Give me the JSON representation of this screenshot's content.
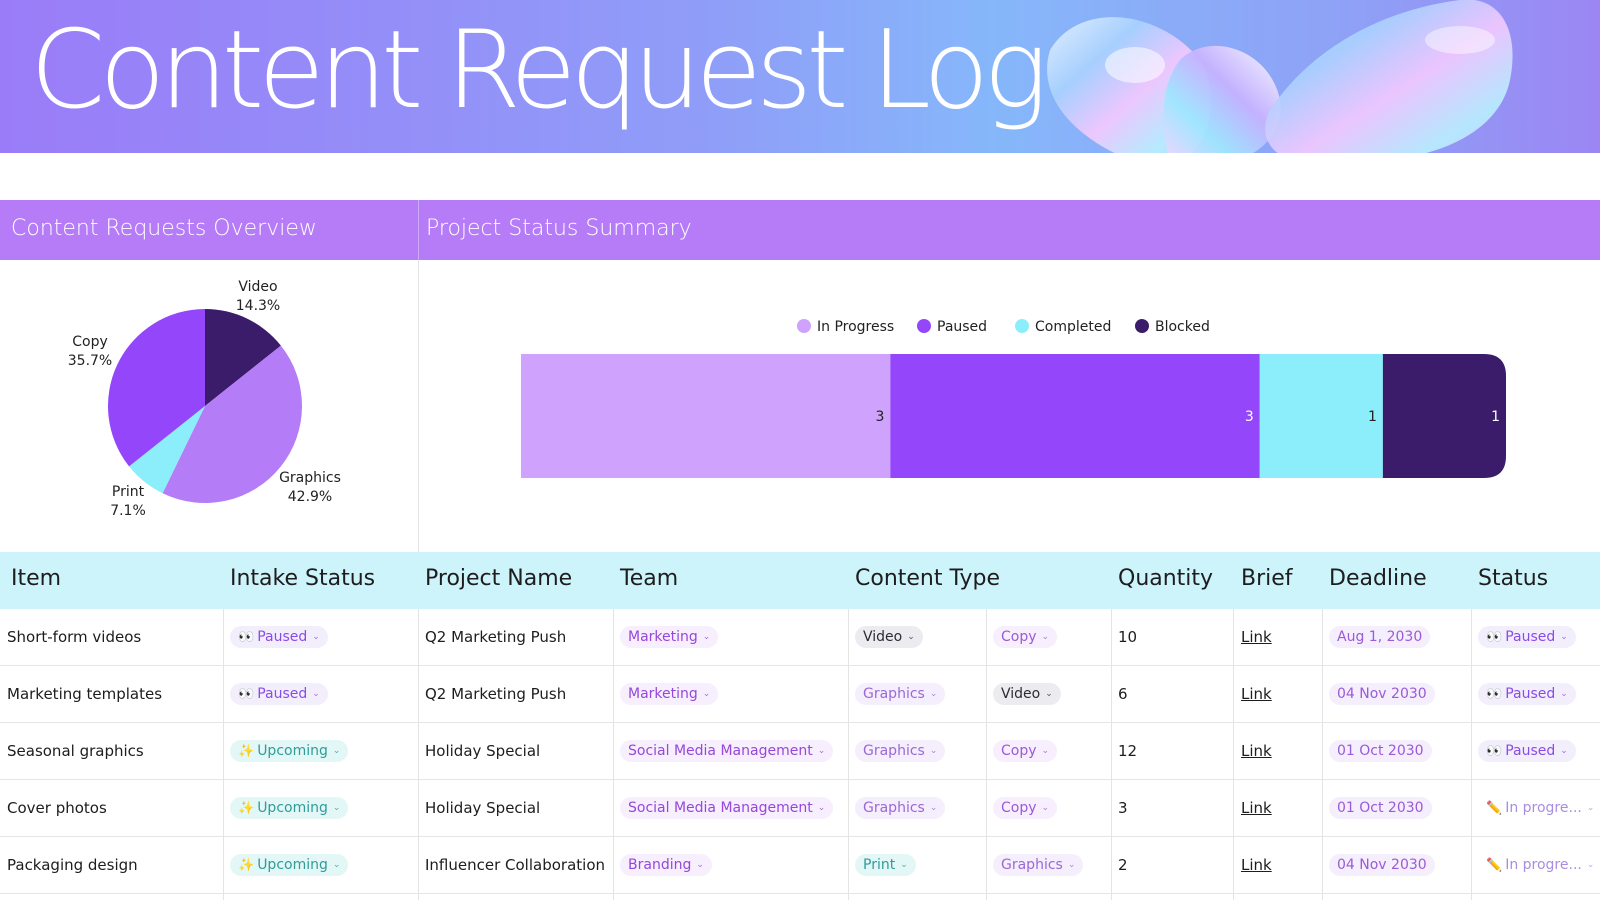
{
  "banner": {
    "title": "Content Request Log"
  },
  "sections": {
    "overview_title": "Content Requests Overview",
    "status_title": "Project Status Summary"
  },
  "chart_data": [
    {
      "type": "pie",
      "title": "",
      "slices": [
        {
          "label": "Video",
          "percent_label": "14.3%",
          "value": 14.3,
          "color": "#3a1c6a"
        },
        {
          "label": "Graphics",
          "percent_label": "42.9%",
          "value": 42.9,
          "color": "#b57cf8"
        },
        {
          "label": "Print",
          "percent_label": "7.1%",
          "value": 7.1,
          "color": "#8ceefb"
        },
        {
          "label": "Copy",
          "percent_label": "35.7%",
          "value": 35.7,
          "color": "#9446fb"
        }
      ]
    },
    {
      "type": "bar",
      "orientation": "horizontal",
      "stacked": true,
      "title": "",
      "legend_position": "top",
      "series": [
        {
          "name": "In Progress",
          "value": 3,
          "color": "#cea2fd"
        },
        {
          "name": "Paused",
          "value": 3,
          "color": "#9446fb"
        },
        {
          "name": "Completed",
          "value": 1,
          "color": "#8ceefb"
        },
        {
          "name": "Blocked",
          "value": 1,
          "color": "#3a1c6a"
        }
      ]
    }
  ],
  "table": {
    "headers": [
      "Item",
      "Intake Status",
      "Project Name",
      "Team",
      "Content Type",
      "Quantity",
      "Brief",
      "Deadline",
      "Status"
    ],
    "rows": [
      {
        "item": "Short-form videos",
        "intake": {
          "icon": "eyes-icon",
          "emoji": "👀",
          "label": "Paused",
          "kind": "paused"
        },
        "project": "Q2 Marketing Push",
        "team": "Marketing",
        "type1": {
          "label": "Video",
          "kind": "video"
        },
        "type2": {
          "label": "Copy",
          "kind": "copy"
        },
        "quantity": "10",
        "brief": "Link",
        "deadline": "Aug 1, 2030",
        "status": {
          "icon": "eyes-icon",
          "emoji": "👀",
          "label": "Paused",
          "kind": "paused"
        }
      },
      {
        "item": "Marketing templates",
        "intake": {
          "icon": "eyes-icon",
          "emoji": "👀",
          "label": "Paused",
          "kind": "paused"
        },
        "project": "Q2 Marketing Push",
        "team": "Marketing",
        "type1": {
          "label": "Graphics",
          "kind": "graphics"
        },
        "type2": {
          "label": "Video",
          "kind": "video"
        },
        "quantity": "6",
        "brief": "Link",
        "deadline": "04 Nov 2030",
        "status": {
          "icon": "eyes-icon",
          "emoji": "👀",
          "label": "Paused",
          "kind": "paused"
        }
      },
      {
        "item": "Seasonal graphics",
        "intake": {
          "icon": "sparkles-icon",
          "emoji": "✨",
          "label": "Upcoming",
          "kind": "upcoming"
        },
        "project": "Holiday Special",
        "team": "Social Media Management",
        "type1": {
          "label": "Graphics",
          "kind": "graphics"
        },
        "type2": {
          "label": "Copy",
          "kind": "copy"
        },
        "quantity": "12",
        "brief": "Link",
        "deadline": "01 Oct 2030",
        "status": {
          "icon": "eyes-icon",
          "emoji": "👀",
          "label": "Paused",
          "kind": "paused"
        }
      },
      {
        "item": "Cover photos",
        "intake": {
          "icon": "sparkles-icon",
          "emoji": "✨",
          "label": "Upcoming",
          "kind": "upcoming"
        },
        "project": "Holiday Special",
        "team": "Social Media Management",
        "type1": {
          "label": "Graphics",
          "kind": "graphics"
        },
        "type2": {
          "label": "Copy",
          "kind": "copy"
        },
        "quantity": "3",
        "brief": "Link",
        "deadline": "01 Oct 2030",
        "status": {
          "icon": "pencil-icon",
          "emoji": "✏️",
          "label": "In progre...",
          "kind": "prog"
        }
      },
      {
        "item": "Packaging design",
        "intake": {
          "icon": "sparkles-icon",
          "emoji": "✨",
          "label": "Upcoming",
          "kind": "upcoming"
        },
        "project": "Influencer Collaboration",
        "team": "Branding",
        "type1": {
          "label": "Print",
          "kind": "print"
        },
        "type2": {
          "label": "Graphics",
          "kind": "graphics"
        },
        "quantity": "2",
        "brief": "Link",
        "deadline": "04 Nov 2030",
        "status": {
          "icon": "pencil-icon",
          "emoji": "✏️",
          "label": "In progre...",
          "kind": "prog"
        }
      }
    ]
  }
}
